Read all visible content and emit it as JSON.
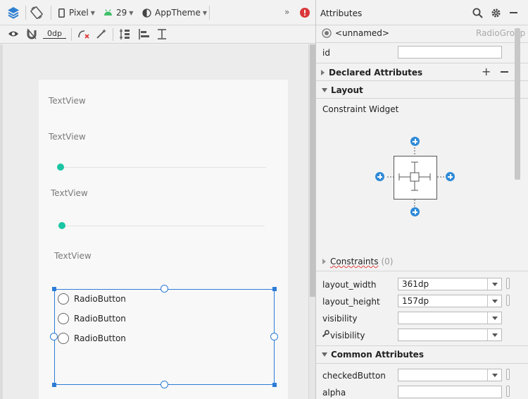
{
  "toolbar": {
    "device": "Pixel",
    "api_level": "29",
    "theme": "AppTheme",
    "margin_value": "0dp",
    "overflow": "»"
  },
  "canvas": {
    "textviews": [
      "TextView",
      "TextView",
      "TextView",
      "TextView"
    ],
    "seekbar_color": "#1bc5a3",
    "radio_buttons": [
      "RadioButton",
      "RadioButton",
      "RadioButton"
    ],
    "selection_color": "#2d7cd6"
  },
  "attributes": {
    "title": "Attributes",
    "component_name": "<unnamed>",
    "component_type": "RadioGroup",
    "id_label": "id",
    "id_value": "",
    "declared_section": "Declared Attributes",
    "layout_section": "Layout",
    "constraint_widget": "Constraint Widget",
    "constraints_label": "Constraints",
    "constraints_count": "(0)",
    "layout_width_label": "layout_width",
    "layout_width_value": "361dp",
    "layout_height_label": "layout_height",
    "layout_height_value": "157dp",
    "visibility_label": "visibility",
    "visibility_value": "",
    "tools_visibility_label": "visibility",
    "tools_visibility_value": "",
    "common_section": "Common Attributes",
    "checked_button_label": "checkedButton",
    "checked_button_value": "",
    "alpha_label": "alpha",
    "alpha_value": ""
  }
}
